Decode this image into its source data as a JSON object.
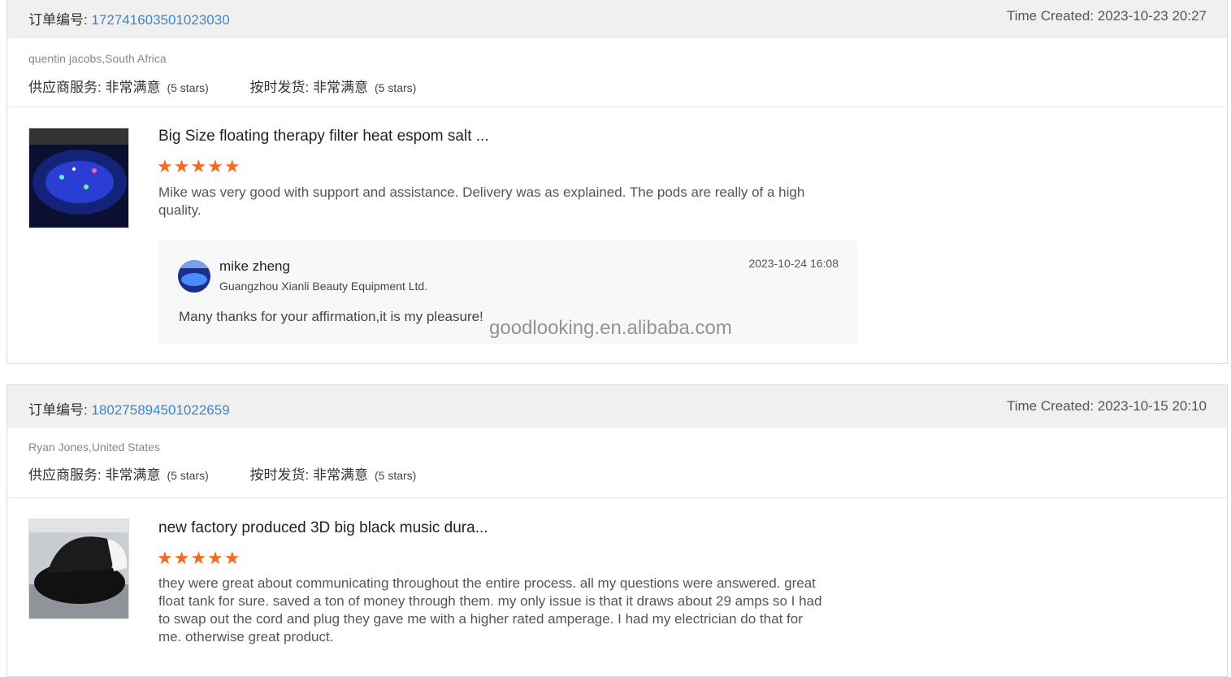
{
  "watermark": "goodlooking.en.alibaba.com",
  "reviews": [
    {
      "order_label": "订单编号:",
      "order_number": "172741603501023030",
      "time_created": "Time Created: 2023-10-23 20:27",
      "buyer": "quentin jacobs,South Africa",
      "rating1_label": "供应商服务: 非常满意",
      "rating1_stars": "(5 stars)",
      "rating2_label": "按时发货: 非常满意",
      "rating2_stars": "(5 stars)",
      "product_title": "Big Size floating therapy filter heat espom salt ...",
      "stars": "★★★★★",
      "review_text": "Mike was very good with support and assistance.  Delivery was as explained. The pods are really of a high quality.",
      "reply": {
        "name": "mike zheng",
        "company": "Guangzhou Xianli Beauty Equipment Ltd.",
        "time": "2023-10-24 16:08",
        "text": "Many thanks for your affirmation,it is my pleasure!"
      }
    },
    {
      "order_label": "订单编号:",
      "order_number": "180275894501022659",
      "time_created": "Time Created: 2023-10-15 20:10",
      "buyer": "Ryan Jones,United States",
      "rating1_label": "供应商服务: 非常满意",
      "rating1_stars": "(5 stars)",
      "rating2_label": "按时发货: 非常满意",
      "rating2_stars": "(5 stars)",
      "product_title": "new factory produced 3D big black music dura...",
      "stars": "★★★★★",
      "review_text": "they were great about communicating throughout the entire process. all my questions were answered.  great float tank for sure. saved a ton of money through them.  my only issue is that it draws about 29 amps so I had to swap out the cord and plug they gave me with a higher rated amperage. I had my electrician do that for me.  otherwise great product."
    }
  ],
  "colors": {
    "accent_link": "#3d86c6",
    "star": "#f36c21"
  }
}
